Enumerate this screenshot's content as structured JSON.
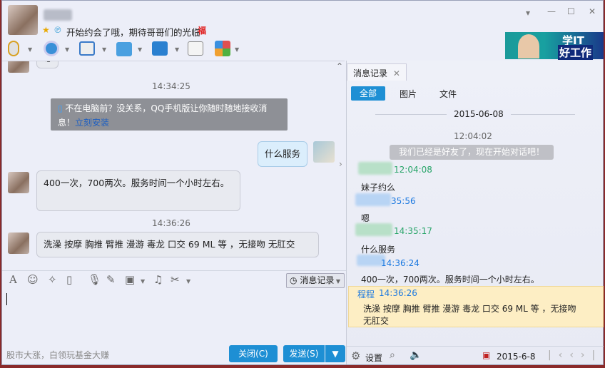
{
  "header": {
    "status_text": "开始约会了哦，期待哥哥们的光临",
    "status_emoji": "福",
    "ad_text_1": "学IT",
    "ad_text_2": "好工作"
  },
  "window_controls": {
    "menu": "▾",
    "minimize": "—",
    "maximize": "☐",
    "close": "✕"
  },
  "toolbar": [
    "microphone-icon",
    "camera-icon",
    "screen-share-icon",
    "file-transfer-icon",
    "remote-assist-icon",
    "add-chat-icon",
    "apps-icon"
  ],
  "chat": {
    "partial_msg": "嗯",
    "ts1": "14:34:25",
    "notice": "不在电脑前？没关系，QQ手机版让你随时随地接收消息！",
    "notice_link": "立刻安装",
    "msg_self": "什么服务",
    "msg_other1": "400一次，700两次。服务时间一个小时左右。",
    "ts2": "14:36:26",
    "msg_other2": "洗澡 按摩 胸推 臂推  漫游  毒龙 口交 69 ML 等 ，无接吻 无肛交"
  },
  "input_toolbar": {
    "history_label": "消息记录"
  },
  "bottom": {
    "ad": "股市大涨，白领玩基金大赚",
    "close_label": "关闭(C)",
    "send_label": "发送(S)"
  },
  "history": {
    "tab_label": "消息记录",
    "filters": [
      "全部",
      "图片",
      "文件"
    ],
    "date": "2015-06-08",
    "sys_time": "12:04:02",
    "sys_msg": "我们已经是好友了，现在开始对话吧！",
    "entries": [
      {
        "time": "12:04:08",
        "text": "妹子约么",
        "color": "#2aa56a"
      },
      {
        "time": "35:56",
        "text": "嗯",
        "color": "#1a78e0"
      },
      {
        "time": "14:35:17",
        "text": "什么服务",
        "color": "#2aa56a"
      },
      {
        "time": "14:36:24",
        "text": "400一次，700两次。服务时间一个小时左右。",
        "color": "#1a78e0"
      }
    ],
    "highlight": {
      "name": "程程",
      "time": "14:36:26",
      "text": "洗澡 按摩 胸推 臂推  漫游  毒龙 口交 69 ML 等 ，无接吻 无肛交"
    },
    "settings_label": "设置",
    "footer_date": "2015-6-8"
  }
}
